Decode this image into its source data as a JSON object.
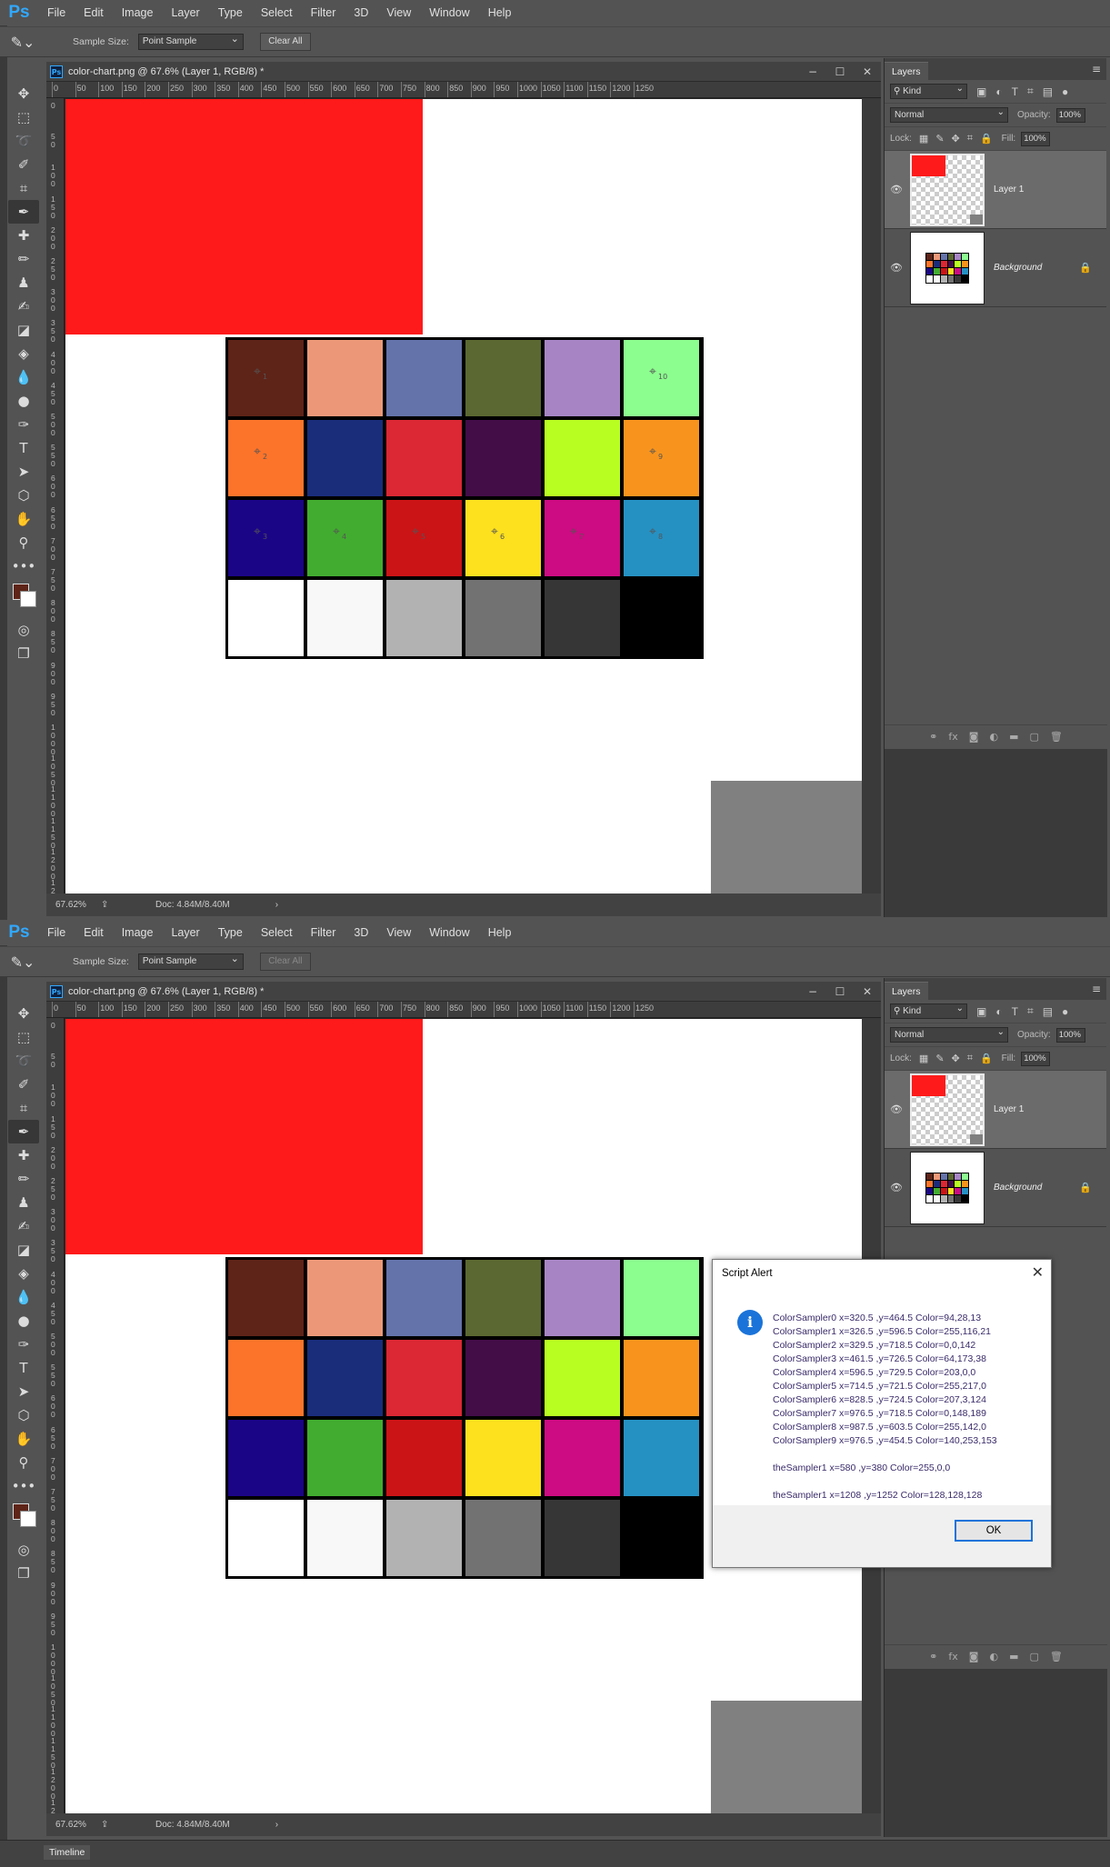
{
  "app": {
    "logo": "Ps"
  },
  "menu": [
    "File",
    "Edit",
    "Image",
    "Layer",
    "Type",
    "Select",
    "Filter",
    "3D",
    "View",
    "Window",
    "Help"
  ],
  "options": {
    "sample_size_label": "Sample Size:",
    "sample_size_value": "Point Sample",
    "clear_all": "Clear All"
  },
  "document": {
    "title": "color-chart.png @ 67.6% (Layer 1, RGB/8) *",
    "ruler_h": [
      "0",
      "50",
      "100",
      "150",
      "200",
      "250",
      "300",
      "350",
      "400",
      "450",
      "500",
      "550",
      "600",
      "650",
      "700",
      "750",
      "800",
      "850",
      "900",
      "950",
      "1000",
      "1050",
      "1100",
      "1150",
      "1200",
      "1250"
    ],
    "ruler_v": [
      "0",
      "50",
      "100",
      "150",
      "200",
      "250",
      "300",
      "350",
      "400",
      "450",
      "500",
      "550",
      "600",
      "650",
      "700",
      "750",
      "800",
      "850",
      "900",
      "950",
      "1000",
      "1050",
      "1100",
      "1150",
      "1200",
      "1250"
    ],
    "zoom": "67.62%",
    "doc_info": "Doc: 4.84M/8.40M",
    "status_arrow": "›",
    "chart_colors": [
      [
        "#5e2418",
        "#ec9878",
        "#6473aa",
        "#5b6831",
        "#a785c4",
        "#8cfd8f"
      ],
      [
        "#fc742a",
        "#1a2d7b",
        "#db2834",
        "#430d48",
        "#b8fe21",
        "#f8941d"
      ],
      [
        "#1b0587",
        "#42ac30",
        "#cb1416",
        "#fde01e",
        "#cd0b82",
        "#2591c3"
      ],
      [
        "#ffffff",
        "#f8f8f8",
        "#b2b2b2",
        "#727272",
        "#363636",
        "#000000"
      ]
    ],
    "samplers": [
      {
        "label": "1",
        "row": 0,
        "col": 0
      },
      {
        "label": "10",
        "row": 0,
        "col": 5
      },
      {
        "label": "2",
        "row": 1,
        "col": 0
      },
      {
        "label": "9",
        "row": 1,
        "col": 5
      },
      {
        "label": "3",
        "row": 2,
        "col": 0
      },
      {
        "label": "4",
        "row": 2,
        "col": 1
      },
      {
        "label": "5",
        "row": 2,
        "col": 2
      },
      {
        "label": "6",
        "row": 2,
        "col": 3
      },
      {
        "label": "7",
        "row": 2,
        "col": 4
      },
      {
        "label": "8",
        "row": 2,
        "col": 5
      }
    ]
  },
  "layers_panel": {
    "tab": "Layers",
    "kind": "Kind",
    "blend_mode": "Normal",
    "opacity_label": "Opacity:",
    "opacity_value": "100%",
    "lock_label": "Lock:",
    "fill_label": "Fill:",
    "fill_value": "100%",
    "layers": [
      {
        "name": "Layer 1",
        "selected": true
      },
      {
        "name": "Background",
        "selected": false
      }
    ]
  },
  "dialog": {
    "title": "Script Alert",
    "lines": [
      "ColorSampler0 x=320.5 ,y=464.5 Color=94,28,13",
      "ColorSampler1 x=326.5 ,y=596.5 Color=255,116,21",
      "ColorSampler2 x=329.5 ,y=718.5 Color=0,0,142",
      "ColorSampler3 x=461.5 ,y=726.5 Color=64,173,38",
      "ColorSampler4 x=596.5 ,y=729.5 Color=203,0,0",
      "ColorSampler5 x=714.5 ,y=721.5 Color=255,217,0",
      "ColorSampler6 x=828.5 ,y=724.5 Color=207,3,124",
      "ColorSampler7 x=976.5 ,y=718.5 Color=0,148,189",
      "ColorSampler8 x=987.5 ,y=603.5 Color=255,142,0",
      "ColorSampler9 x=976.5 ,y=454.5 Color=140,253,153"
    ],
    "sampler_line_a": "theSampler1 x=580 ,y=380 Color=255,0,0",
    "sampler_line_b": "theSampler1 x=1208 ,y=1252 Color=128,128,128",
    "ok": "OK"
  },
  "timeline": {
    "tab": "Timeline"
  }
}
